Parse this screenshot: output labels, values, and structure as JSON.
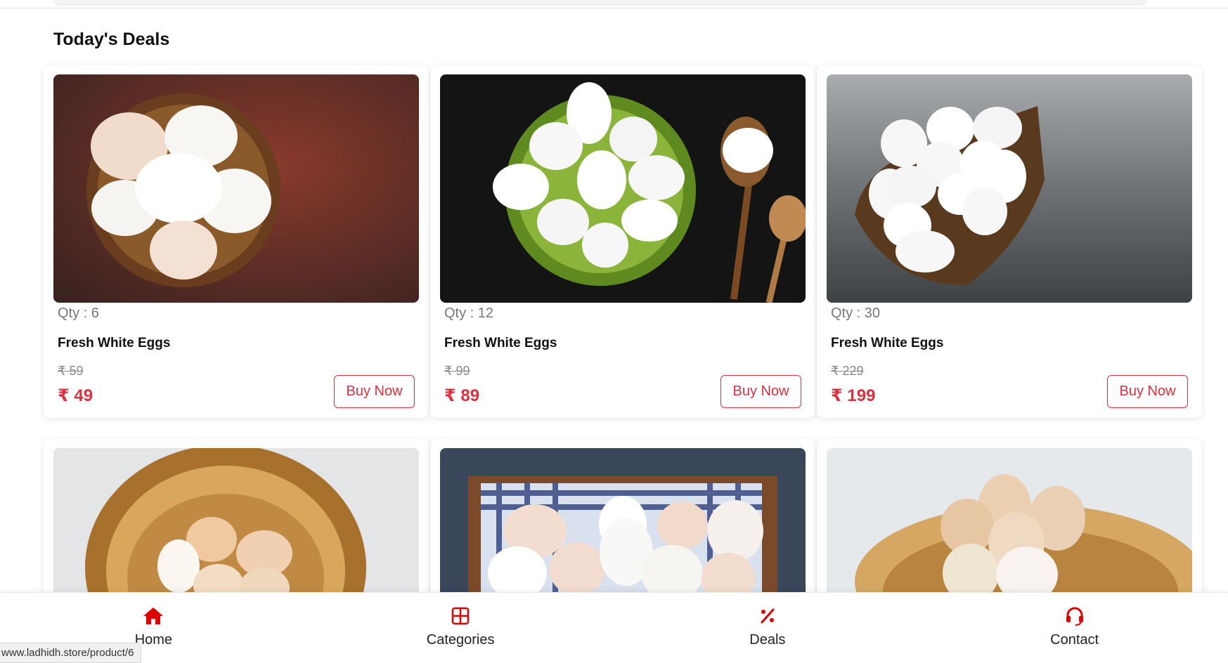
{
  "section": {
    "title": "Today's Deals"
  },
  "deals": [
    {
      "qty": "Qty : 6",
      "name": "Fresh White Eggs",
      "mrp": "₹ 59",
      "price": "₹ 49",
      "button": "Buy Now"
    },
    {
      "qty": "Qty : 12",
      "name": "Fresh White Eggs",
      "mrp": "₹ 99",
      "price": "₹ 89",
      "button": "Buy Now"
    },
    {
      "qty": "Qty : 30",
      "name": "Fresh White Eggs",
      "mrp": "₹ 229",
      "price": "₹ 199",
      "button": "Buy Now"
    }
  ],
  "bottom_nav": [
    {
      "label": "Home",
      "icon": "home-icon",
      "active": true
    },
    {
      "label": "Categories",
      "icon": "grid-icon",
      "active": false
    },
    {
      "label": "Deals",
      "icon": "percent-icon",
      "active": false
    },
    {
      "label": "Contact",
      "icon": "headset-icon",
      "active": false
    }
  ],
  "status_bar": {
    "url": "www.ladhidh.store/product/6"
  },
  "colors": {
    "accent": "#dc2f3f",
    "nav_icon": "#e00000"
  }
}
